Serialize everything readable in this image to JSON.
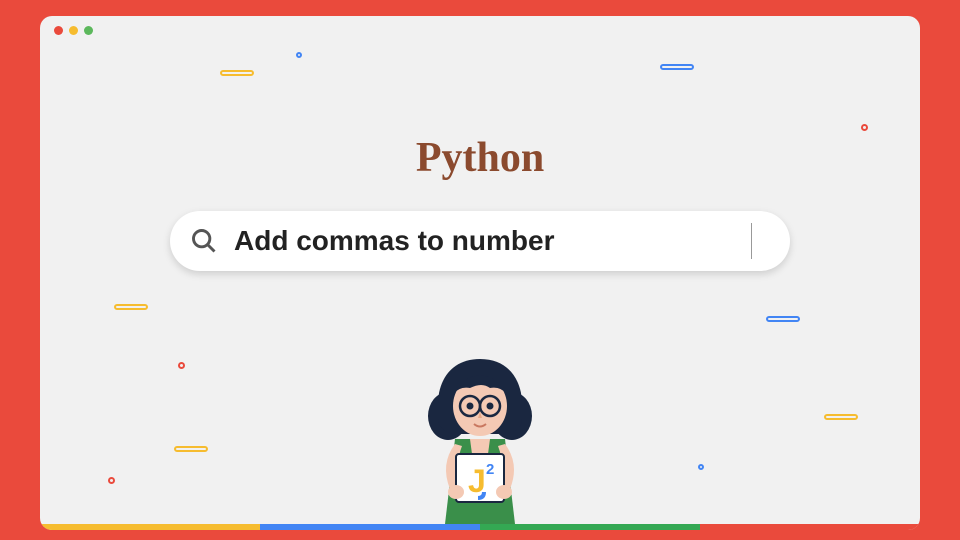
{
  "title": "Python",
  "search": {
    "query": "Add commas to number"
  },
  "logo": {
    "text": "J",
    "superscript": "2"
  },
  "colors": {
    "red": "#ea4a3c",
    "yellow": "#f6bc2f",
    "green": "#34a853",
    "blue": "#4285f4"
  }
}
